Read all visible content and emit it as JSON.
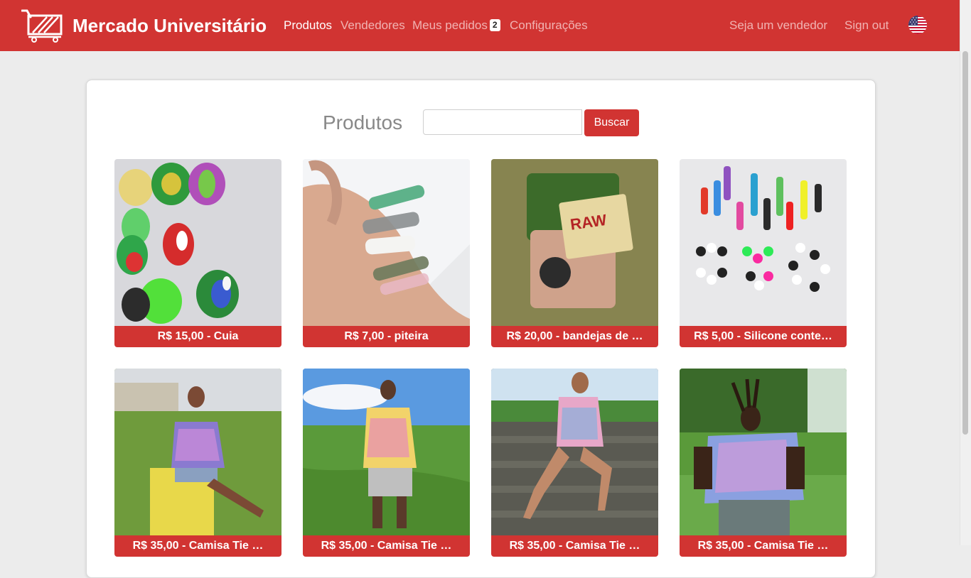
{
  "brand": {
    "name": "Mercado Universitário",
    "logo_icon": "shopping-cart-icon"
  },
  "nav": {
    "links": [
      {
        "label": "Produtos",
        "active": true
      },
      {
        "label": "Vendedores",
        "active": false
      },
      {
        "label": "Meus pedidos",
        "active": false,
        "badge": "2"
      },
      {
        "label": "Configurações",
        "active": false
      }
    ],
    "right": [
      {
        "label": "Seja um vendedor"
      },
      {
        "label": "Sign out"
      }
    ],
    "language_icon": "us-flag-icon"
  },
  "main": {
    "title": "Produtos",
    "search": {
      "value": "",
      "placeholder": "",
      "button_label": "Buscar"
    },
    "products": [
      {
        "label": "R$ 15,00 - Cuia",
        "image": "silicone-bowls-photo"
      },
      {
        "label": "R$ 7,00 - piteira",
        "image": "glass-tips-photo"
      },
      {
        "label": "R$ 20,00 - bandejas de …",
        "image": "rolling-trays-photo"
      },
      {
        "label": "R$ 5,00 - Silicone conte…",
        "image": "silicone-containers-photo"
      },
      {
        "label": "R$ 35,00 - Camisa Tie …",
        "image": "tie-dye-shirt-woman-photo"
      },
      {
        "label": "R$ 35,00 - Camisa Tie …",
        "image": "tie-dye-shirt-man-photo"
      },
      {
        "label": "R$ 35,00 - Camisa Tie …",
        "image": "tie-dye-shirt-woman-stairs-photo"
      },
      {
        "label": "R$ 35,00 - Camisa Tie …",
        "image": "tie-dye-shirt-man-field-photo"
      }
    ]
  },
  "colors": {
    "brand": "#d13432",
    "nav_inactive": "#f1b3b2",
    "background": "#ececec"
  }
}
